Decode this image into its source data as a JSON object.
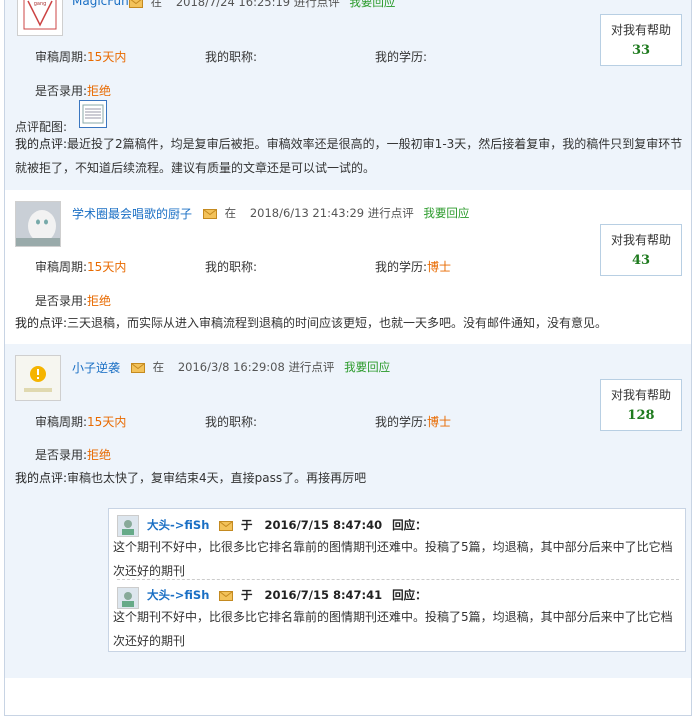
{
  "common": {
    "in_word": "在",
    "did_review": "进行点评",
    "reply_link": "我要回应",
    "help_label": "对我有帮助",
    "period_label": "审稿周期:",
    "title_label": "我的职称:",
    "edu_label": "我的学历:",
    "accepted_label": "是否录用:",
    "review_label": "我的点评:",
    "image_label": "点评配图:"
  },
  "reviews": [
    {
      "user": "MagicFun",
      "datetime": "2018/7/24 16:25:19",
      "help_count": "33",
      "period": "15天内",
      "title": "",
      "education": "",
      "accepted": "拒绝",
      "comment": "最近投了2篇稿件，均是复审后被拒。审稿效率还是很高的，一般初审1-3天，然后接着复审，我的稿件只到复审环节就被拒了，不知道后续流程。建议有质量的文章还是可以试一试的。"
    },
    {
      "user": "学术圈最会唱歌的厨子",
      "datetime": "2018/6/13 21:43:29",
      "help_count": "43",
      "period": "15天内",
      "title": "",
      "education": "博士",
      "accepted": "拒绝",
      "comment": "三天退稿，而实际从进入审稿流程到退稿的时间应该更短，也就一天多吧。没有邮件通知，没有意见。"
    },
    {
      "user": "小子逆袭",
      "datetime": "2016/3/8 16:29:08",
      "help_count": "128",
      "period": "15天内",
      "title": "",
      "education": "博士",
      "accepted": "拒绝",
      "comment": "审稿也太快了，复审结束4天，直接pass了。再接再厉吧"
    }
  ],
  "replies": {
    "yu": "于",
    "respond": "回应：",
    "items": [
      {
        "user": "大头->fiSh",
        "datetime": "2016/7/15 8:47:40",
        "text": "这个期刊不好中，比很多比它排名靠前的图情期刊还难中。投稿了5篇，均退稿，其中部分后来中了比它档次还好的期刊"
      },
      {
        "user": "大头->fiSh",
        "datetime": "2016/7/15 8:47:41",
        "text": "这个期刊不好中，比很多比它排名靠前的图情期刊还难中。投稿了5篇，均退稿，其中部分后来中了比它档次还好的期刊"
      }
    ]
  },
  "icons": {
    "mail": "mail-icon",
    "image_thumb": "image-thumbnail-icon"
  },
  "colors": {
    "username": "#1a6fc4",
    "value": "#e86a00",
    "reply_link": "#2a9a2a",
    "help_count": "#1e7a1e",
    "block_bg": "#eef4fb"
  }
}
